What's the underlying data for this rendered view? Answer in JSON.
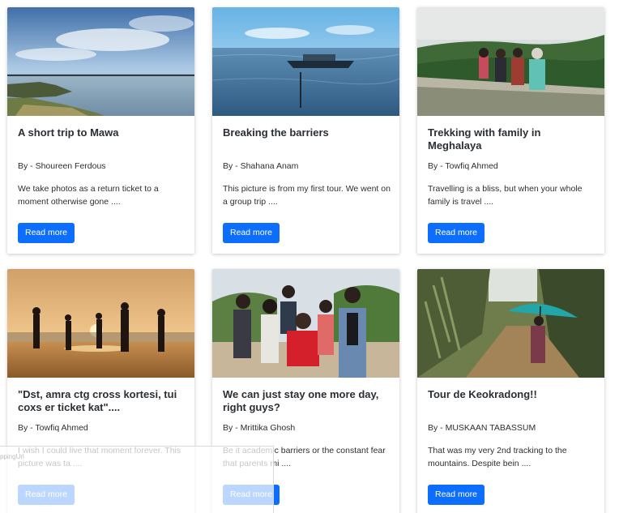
{
  "cards": [
    {
      "title": "A short trip to Mawa",
      "author": "By - Shoureen Ferdous",
      "excerpt": "We take photos as a return ticket to a moment otherwise gone ....",
      "button": "Read more"
    },
    {
      "title": "Breaking the barriers",
      "author": "By - Shahana Anam",
      "excerpt": "This picture is from my first tour. We went on a group trip ....",
      "button": "Read more"
    },
    {
      "title": "Trekking with family in Meghalaya",
      "author": "By - Towfiq Ahmed",
      "excerpt": "Travelling is a bliss, but when your whole family is travel ....",
      "button": "Read more"
    },
    {
      "title": "\"Dst, amra ctg cross kortesi, tui coxs er ticket kat\"....",
      "author": "By - Towfiq Ahmed",
      "excerpt": "I wish I could live that moment forever. This picture was ta ....",
      "button": "Read more"
    },
    {
      "title": "We can just stay one more day, right guys?",
      "author": "By - Mrittika Ghosh",
      "excerpt": "Be it academic barriers or the constant fear that parents mi ....",
      "button": "Read more"
    },
    {
      "title": "Tour de Keokradong!!",
      "author": "By - MUSKAAN TABASSUM",
      "excerpt": "That was my very 2nd tracking to the mountains. Despite bein ....",
      "button": "Read more"
    }
  ],
  "overlay": {
    "text": "ppingUrl"
  },
  "colors": {
    "button": "#0d6efd",
    "text": "#2b2f33"
  }
}
